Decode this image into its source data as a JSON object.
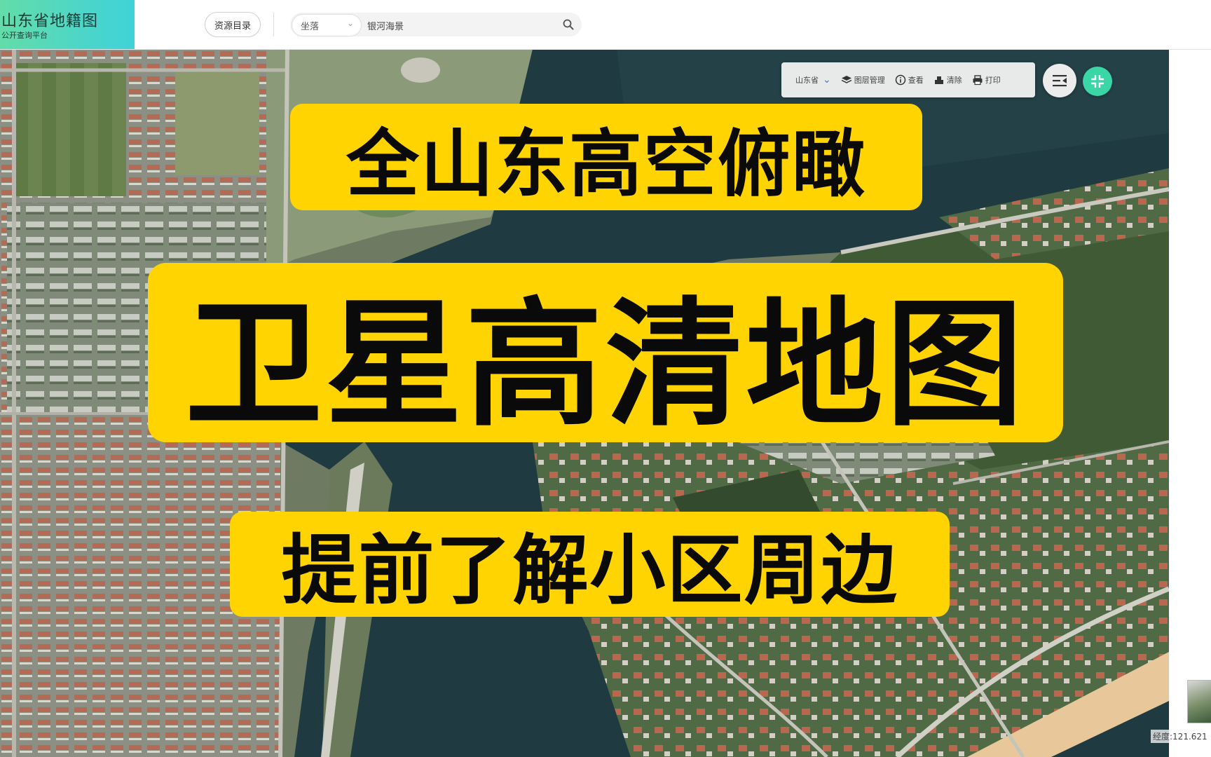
{
  "app": {
    "title": "山东省地籍图",
    "subtitle": "公开查询平台"
  },
  "header": {
    "catalog_button": "资源目录",
    "search": {
      "type_selected": "坐落",
      "value": "银河海景",
      "placeholder": ""
    }
  },
  "map_toolbar": {
    "region": "山东省",
    "items": [
      {
        "label": "图层管理",
        "icon": "layers-icon"
      },
      {
        "label": "查看",
        "icon": "info-icon"
      },
      {
        "label": "清除",
        "icon": "eraser-icon"
      },
      {
        "label": "打印",
        "icon": "printer-icon"
      }
    ]
  },
  "map": {
    "coordinate_readout": "经度:121.621"
  },
  "banners": {
    "top": "全山东高空俯瞰",
    "main": "卫星高清地图",
    "bottom": "提前了解小区周边"
  },
  "colors": {
    "banner_bg": "#ffd400",
    "accent": "#3bd6a6",
    "logo_gradient_start": "#63dca8",
    "water": "#1f3a40",
    "vegetation": "#3f5a35"
  }
}
